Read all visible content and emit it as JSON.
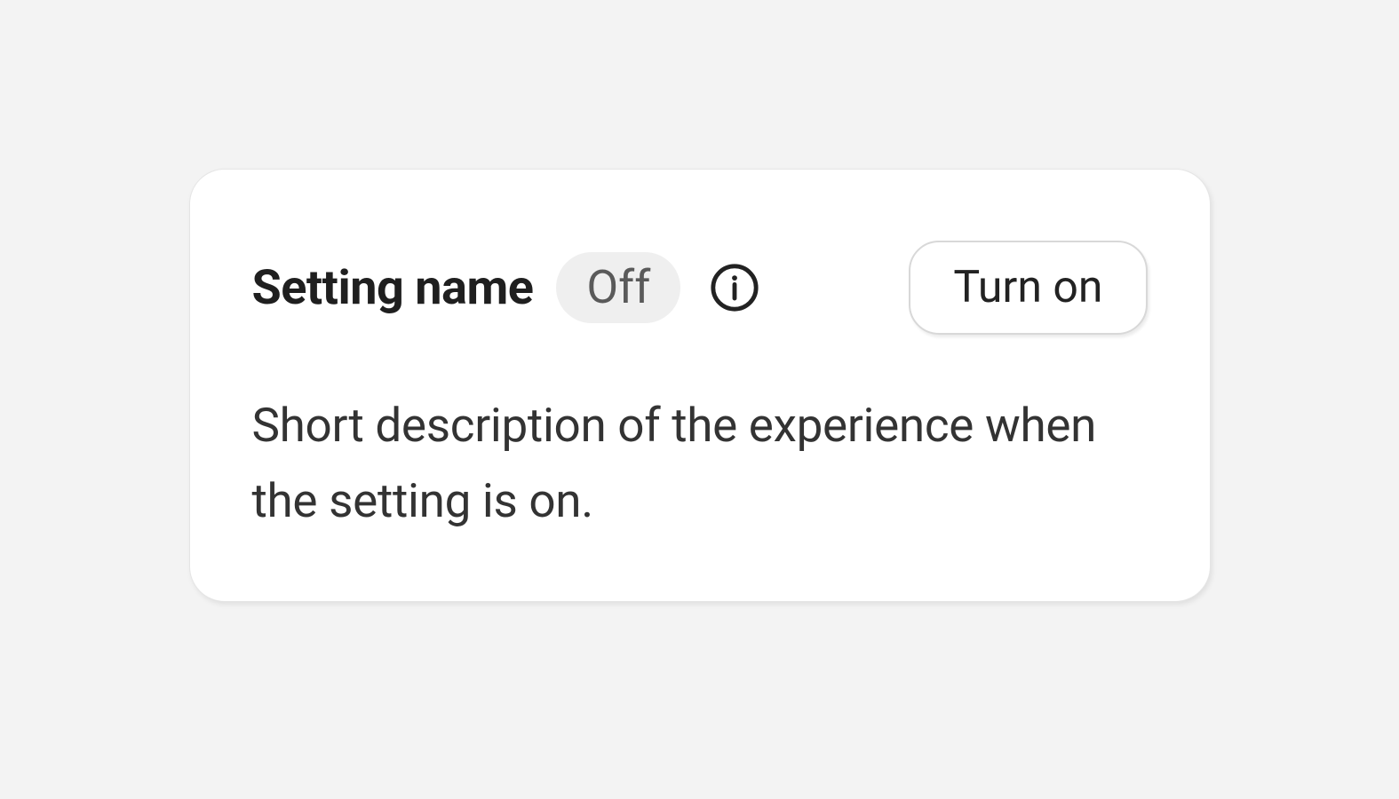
{
  "setting": {
    "title": "Setting name",
    "status": "Off",
    "action_label": "Turn on",
    "description": "Short description of the experience when the setting is on."
  }
}
